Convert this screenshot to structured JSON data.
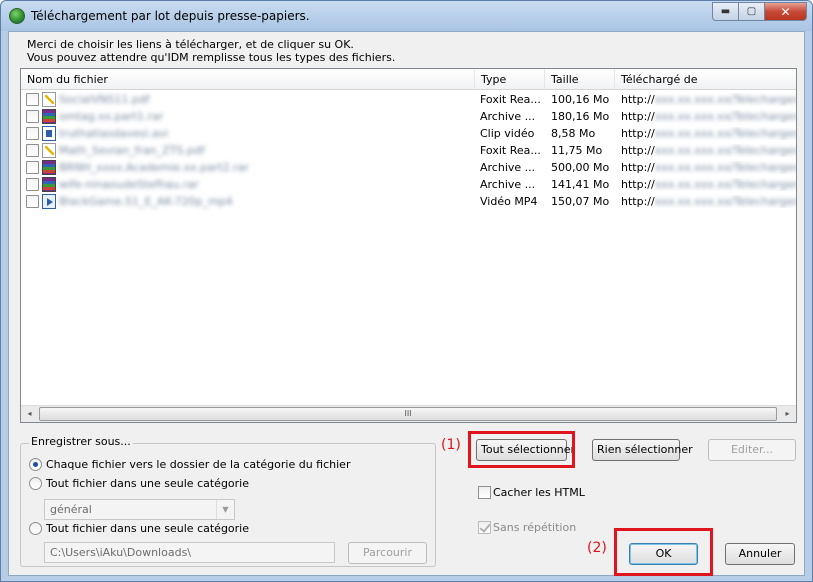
{
  "window": {
    "title": "Téléchargement par lot depuis presse-papiers.",
    "min_glyph": "▬",
    "max_glyph": "▢",
    "close_glyph": "✕"
  },
  "instructions": {
    "line1": "Merci de choisir les liens à télécharger, et de cliquer su OK.",
    "line2": "Vous pouvez attendre qu'IDM remplisse tous les types des fichiers."
  },
  "columns": {
    "name": "Nom du fichier",
    "type": "Type",
    "size": "Taille",
    "from": "Téléchargé de"
  },
  "files": [
    {
      "name": "SocialVNS11.pdf",
      "icon": "pdf-icon",
      "type": "Foxit Rea...",
      "size": "100,16  Mo",
      "from_prefix": "http://",
      "from_rest": "xxx.xx.xxx.xx/Telecharger/fic"
    },
    {
      "name": "omtag.xx.part1.rar",
      "icon": "rar-icon",
      "type": "Archive ...",
      "size": "180,16  Mo",
      "from_prefix": "http://",
      "from_rest": "xxx.xx.xxx.xx/Telecharger/fic"
    },
    {
      "name": "truthatlasdavesi.avi",
      "icon": "video-icon",
      "type": "Clip vidéo",
      "size": "8,58  Mo",
      "from_prefix": "http://",
      "from_rest": "xxx.xx.xxx.xx/Telecharger/fic"
    },
    {
      "name": "Math_Sevian_fran_ZTS.pdf",
      "icon": "pdf-icon",
      "type": "Foxit Rea...",
      "size": "11,75  Mo",
      "from_prefix": "http://",
      "from_rest": "xxx.xx.xxx.xx/Telecharger/fic"
    },
    {
      "name": "BRNH_xxxx.Academie.xx.part2.rar",
      "icon": "rar-icon",
      "type": "Archive ...",
      "size": "500,00  Mo",
      "from_prefix": "http://",
      "from_rest": "xxx.xx.xxx.xx/Telecharger/fic"
    },
    {
      "name": "wife-ninaoudeStefhau.rar",
      "icon": "rar-icon",
      "type": "Archive ...",
      "size": "141,41  Mo",
      "from_prefix": "http://",
      "from_rest": "xxx.xx.xxx.xx/Telecharger/fic"
    },
    {
      "name": "BlackGame.S1_E_AK-720p_mp4",
      "icon": "mp4-icon",
      "type": "Vidéo MP4",
      "size": "150,07  Mo",
      "from_prefix": "http://",
      "from_rest": "xxx.xx.xxx.xx/Telecharger/fic"
    }
  ],
  "scroll": {
    "left": "◂",
    "right": "▸",
    "thumb": "III"
  },
  "save_as": {
    "legend": "Enregistrer sous...",
    "option1": "Chaque fichier vers le dossier de la catégorie du fichier",
    "option2": "Tout fichier dans une seule catégorie",
    "category_value": "général",
    "combo_arrow": "▼",
    "option3": "Tout fichier dans une seule catégorie",
    "path_value": "C:\\Users\\iAku\\Downloads\\",
    "browse_label": "Parcourir"
  },
  "actions": {
    "select_all": "Tout sélectionner",
    "select_none": "Rien sélectionner",
    "edit": "Editer...",
    "hide_html": "Cacher les HTML",
    "no_repeat": "Sans répétition",
    "ok": "OK",
    "cancel": "Annuler"
  },
  "annotations": {
    "a1": "(1)",
    "a2": "(2)",
    "color": "#e0141c"
  }
}
